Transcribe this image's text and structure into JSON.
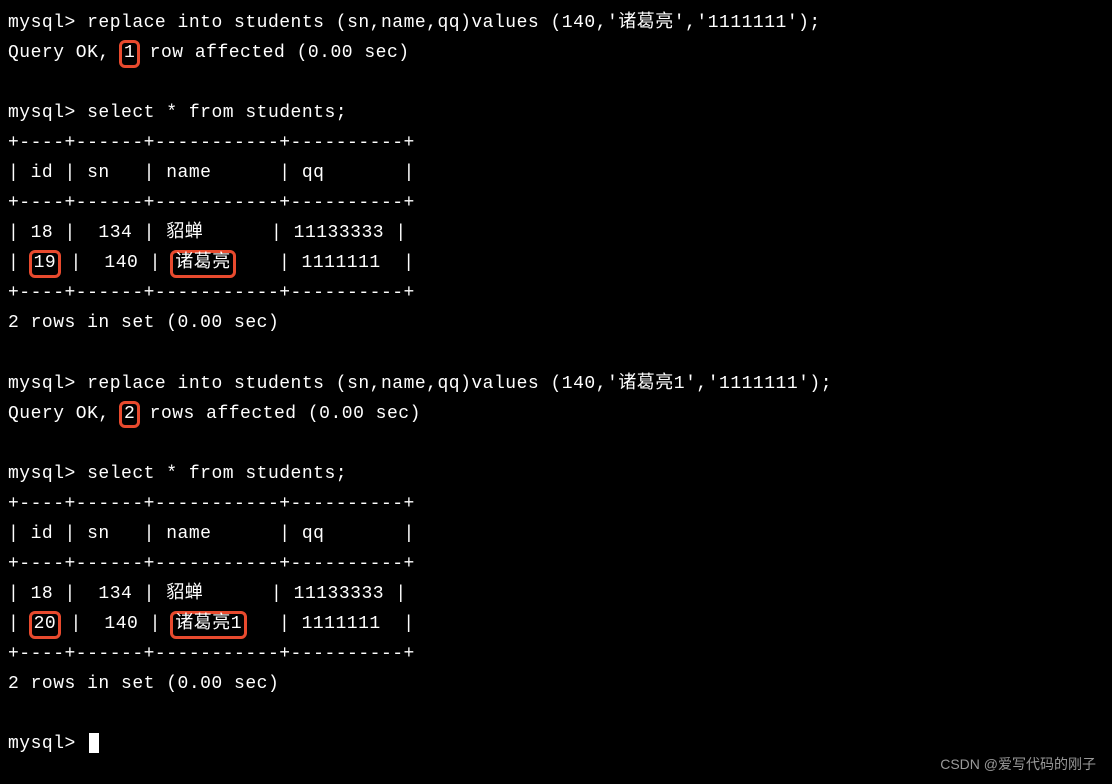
{
  "prompt": "mysql>",
  "cmd1": "replace into students (sn,name,qq)values (140,'诸葛亮','1111111');",
  "result1_pre": "Query OK, ",
  "result1_num": "1",
  "result1_post": " row affected (0.00 sec)",
  "cmd2": "select * from students;",
  "sep_top": "+----+------+-----------+----------+",
  "header_row": "| id | sn   | name      | qq       |",
  "t1r1": "| 18 |  134 | 貂蝉      | 11133333 |",
  "t1r2_a": "| ",
  "t1r2_id": "19",
  "t1r2_b": " |  140 | ",
  "t1r2_name": "诸葛亮",
  "t1r2_c": "    | 1111111  |",
  "summary1": "2 rows in set (0.00 sec)",
  "cmd3": "replace into students (sn,name,qq)values (140,'诸葛亮1','1111111');",
  "result2_pre": "Query OK, ",
  "result2_num": "2",
  "result2_post": " rows affected (0.00 sec)",
  "cmd4": "select * from students;",
  "t2r1": "| 18 |  134 | 貂蝉      | 11133333 |",
  "t2r2_a": "| ",
  "t2r2_id": "20",
  "t2r2_b": " |  140 | ",
  "t2r2_name": "诸葛亮1",
  "t2r2_c": "   | 1111111  |",
  "summary2": "2 rows in set (0.00 sec)",
  "watermark": "CSDN @爱写代码的刚子"
}
